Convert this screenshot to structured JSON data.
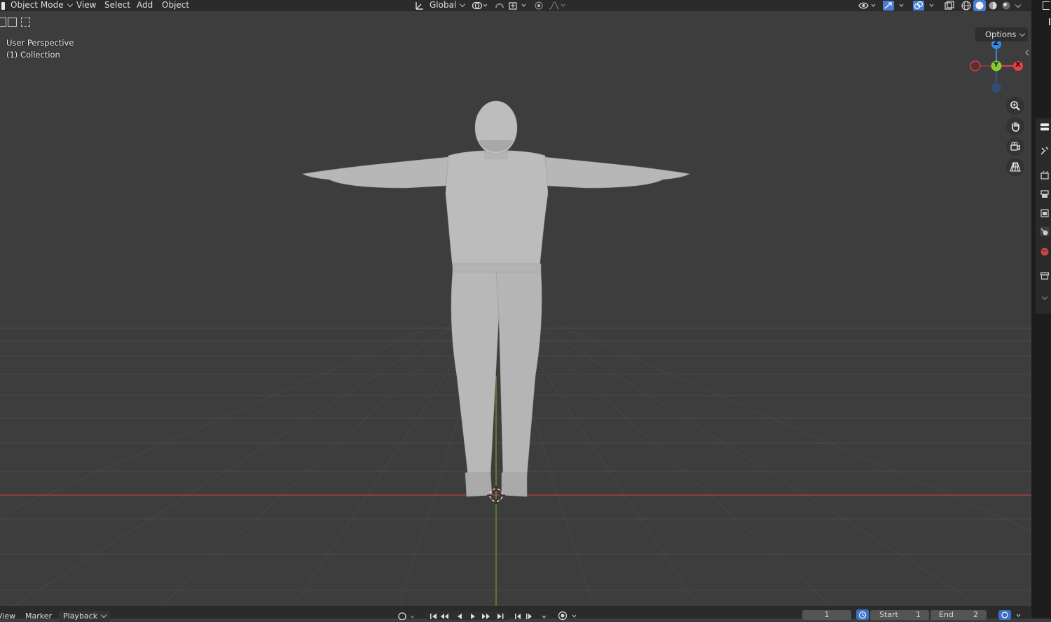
{
  "header": {
    "mode_label": "Object Mode",
    "menus": [
      "View",
      "Select",
      "Add",
      "Object"
    ],
    "transform_orientation": "Global"
  },
  "viewport": {
    "perspective_label": "User Perspective",
    "collection_label": "(1) Collection",
    "options_label": "Options",
    "gizmo": {
      "x_label": "X",
      "y_label": "Y",
      "z_label": "Z"
    }
  },
  "timeline": {
    "menus": [
      "View",
      "Marker",
      "Playback"
    ],
    "current_frame": "1",
    "start_label": "Start",
    "start_value": "1",
    "end_label": "End",
    "end_value": "2"
  },
  "colors": {
    "x_axis": "#c23b3b",
    "y_axis": "#6aa32a",
    "gizmo_x": "#e2414f",
    "gizmo_y": "#8bc834",
    "gizmo_z": "#3b86e0",
    "active_blue": "#4a7ed6"
  }
}
